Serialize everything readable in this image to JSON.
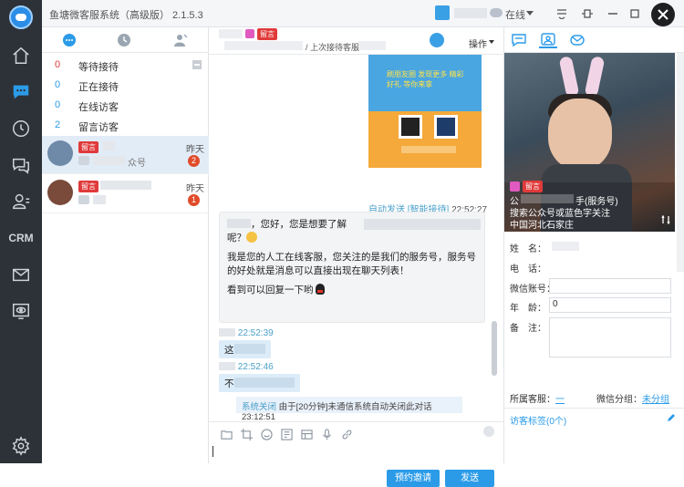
{
  "app": {
    "title": "鱼塘微客服系统（高级版） 2.1.5.3",
    "status": "在线"
  },
  "rail": {
    "crm_label": "CRM"
  },
  "session_list": {
    "categories": [
      {
        "count": "0",
        "label": "等待接待",
        "color": "#e03a3a"
      },
      {
        "count": "0",
        "label": "正在接待",
        "color": "#2b9be8"
      },
      {
        "count": "0",
        "label": "在线访客",
        "color": "#2b9be8"
      },
      {
        "count": "2",
        "label": "留言访客",
        "color": "#2b9be8"
      }
    ],
    "sessions": [
      {
        "tag": "留言",
        "name": "",
        "sub": "众号",
        "time": "昨天",
        "badge": "2"
      },
      {
        "tag": "留言",
        "name": "",
        "sub": "",
        "time": "昨天",
        "badge": "1"
      }
    ]
  },
  "chat": {
    "header_tag": "留言",
    "header_line2": "/ 上次接待客服",
    "ops_label": "操作",
    "poster_text": "刷朋友圈 发现更多 精彩好礼 等你来拿",
    "auto_meta": {
      "label": "自动发送",
      "tag": "[智能接待]",
      "time": "22:52:27"
    },
    "agent_msg": {
      "line1": "，您好，您是想要了解",
      "line1b": "呢？",
      "line2": "我是您的人工在线客服，您关注的是我们的服务号，服务号的好处就是消息可以直接出现在聊天列表！",
      "line3": "看到可以回复一下哟"
    },
    "visitor_msgs": [
      {
        "time": "22:52:39",
        "text": "这"
      },
      {
        "time": "22:52:46",
        "text": "不"
      }
    ],
    "system_note": {
      "label": "系统关闭",
      "text": "由于[20分钟]未通信系统自动关闭此对话",
      "time": "23:12:51"
    },
    "invite_label": "预约邀请",
    "send_label": "发送"
  },
  "info": {
    "photo_tag": "留言",
    "photo_line1a": "公",
    "photo_line1b": "手(服务号)",
    "photo_line2": "搜索公众号或蓝色字关注",
    "photo_line3": "中国河北石家庄",
    "fields": {
      "name_label": "姓　名：",
      "phone_label": "电　话：",
      "wechat_label": "微信账号：",
      "age_label": "年　龄：",
      "age_value": "0",
      "note_label": "备　注："
    },
    "owner_label": "所属客服：",
    "owner_value": "一",
    "group_label": "微信分组：",
    "group_value": "未分组",
    "tags_label": "访客标签(0个)"
  }
}
